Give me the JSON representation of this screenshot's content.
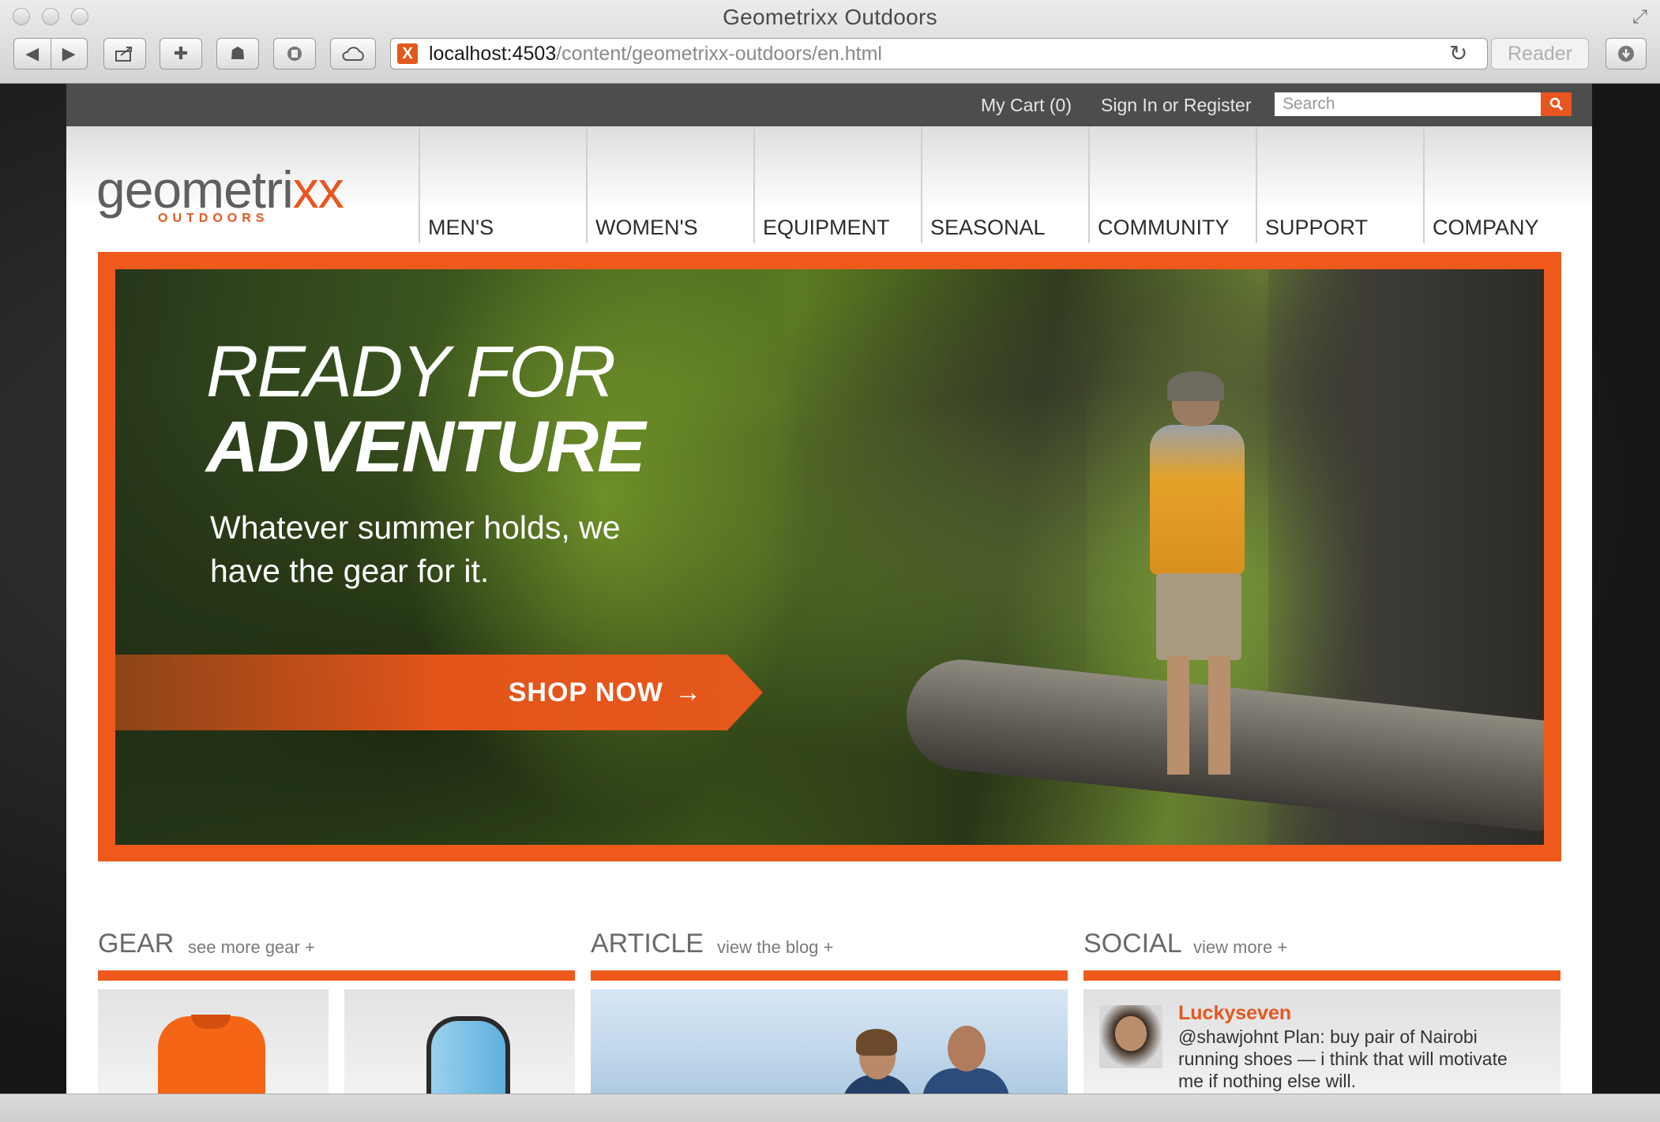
{
  "browser": {
    "window_title": "Geometrixx Outdoors",
    "url_host": "localhost:4503",
    "url_path": "/content/geometrixx-outdoors/en.html",
    "reader_label": "Reader",
    "icons": [
      "back-icon",
      "forward-icon",
      "share-icon",
      "bookmark-plus-icon",
      "top-sites-icon",
      "stop-icon",
      "cloud-icon",
      "reload-icon",
      "downloads-icon",
      "fullscreen-icon"
    ]
  },
  "site": {
    "cart_label": "My Cart (0)",
    "signin_label": "Sign In or Register",
    "search_placeholder": "Search",
    "logo": {
      "word": "geometri",
      "x": "xx",
      "subtitle": "OUTDOORS"
    },
    "nav": [
      "MEN'S",
      "WOMEN'S",
      "EQUIPMENT",
      "SEASONAL",
      "COMMUNITY",
      "SUPPORT",
      "COMPANY"
    ],
    "accent_color": "#ef5a1c"
  },
  "hero": {
    "line1": "READY FOR",
    "line2": "ADVENTURE",
    "subtitle": "Whatever summer holds, we have the gear for it.",
    "cta_label": "SHOP NOW",
    "cta_arrow": "→"
  },
  "sections": {
    "gear": {
      "title": "GEAR",
      "link": "see more gear +"
    },
    "article": {
      "title": "ARTICLE",
      "link": "view the blog +"
    },
    "social": {
      "title": "SOCIAL",
      "link": "view more +",
      "tweet": {
        "user": "Luckyseven",
        "text": "@shawjohnt Plan: buy pair of Nairobi running shoes — i think that will motivate me if nothing else will."
      }
    }
  }
}
